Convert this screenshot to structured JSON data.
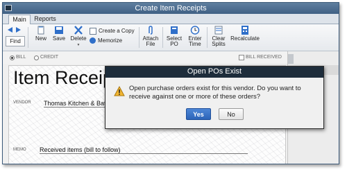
{
  "window": {
    "title": "Create Item Receipts"
  },
  "tabs": [
    {
      "label": "Main"
    },
    {
      "label": "Reports"
    }
  ],
  "toolbar": {
    "find": "Find",
    "new": "New",
    "save": "Save",
    "delete": "Delete",
    "create_copy": "Create a Copy",
    "memorize": "Memorize",
    "attach_file": [
      "Attach",
      "File"
    ],
    "select_po": [
      "Select",
      "PO"
    ],
    "enter_time": [
      "Enter",
      "Time"
    ],
    "clear_splits": [
      "Clear",
      "Splits"
    ],
    "recalculate": "Recalculate"
  },
  "options": {
    "bill": "BILL",
    "credit": "CREDIT",
    "bill_received": "BILL RECEIVED"
  },
  "form": {
    "title": "Item Receipt",
    "vendor_label": "VENDOR",
    "vendor_value": "Thomas Kitchen & Bath",
    "memo_label": "MEMO",
    "memo_value": "Received items (bill to follow)"
  },
  "dialog": {
    "title": "Open POs Exist",
    "message": "Open purchase orders exist for this vendor. Do you want to receive against one or more of these orders?",
    "yes": "Yes",
    "no": "No"
  },
  "colors": {
    "title_bar": "#4a6b8f",
    "dialog_title": "#1e2d3b",
    "yes_button": "#3a72c8"
  }
}
